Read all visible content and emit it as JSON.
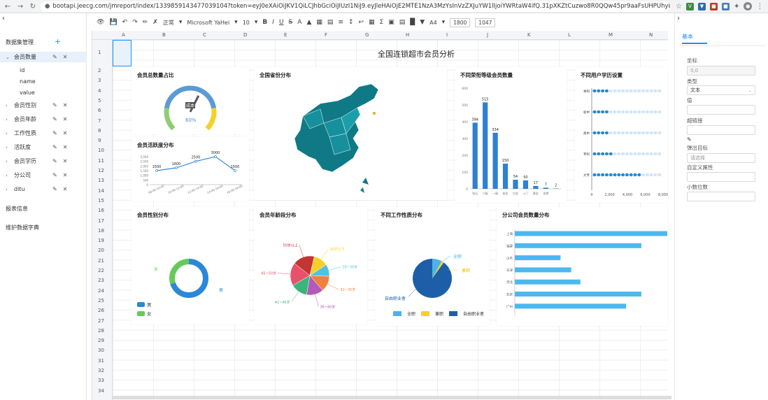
{
  "browser": {
    "url": "bootapi.jeecg.com/jmreport/index/1339859143477039104?token=eyJ0eXAiOiJKV1QiLCJhbGciOiJIUzI1NiJ9.eyJleHAiOjE2MTE1NzA3MzYsInVzZXJuYW1lIjoiYWRtaW4ifQ.31pXKZtCuzwo8R0QQw45pr9aaFsUHPUhybn4XZ9zYpo"
  },
  "left_panel": {
    "dataset_title": "数据集管理",
    "add_label": "+",
    "datasets": [
      {
        "name": "会员数量",
        "expanded": true,
        "fields": [
          "id",
          "name",
          "value"
        ]
      },
      {
        "name": "会员性别"
      },
      {
        "name": "会员年龄"
      },
      {
        "name": "工作性质"
      },
      {
        "name": "活跃度"
      },
      {
        "name": "会员学历"
      },
      {
        "name": "分公司"
      },
      {
        "name": "ditu"
      }
    ],
    "report_info": "报表信息",
    "dict_label": "维护数据字典"
  },
  "toolbar": {
    "font_style": "正常",
    "font_family": "Microsoft YaHei",
    "font_size": "10",
    "paper": "A4",
    "width": "1800",
    "height": "1047"
  },
  "sheet": {
    "columns": [
      "A",
      "B",
      "C",
      "D",
      "E",
      "F",
      "G",
      "H",
      "I",
      "J",
      "K",
      "L",
      "M",
      "N",
      "O"
    ],
    "rows": [
      "1",
      "2",
      "3",
      "4",
      "5",
      "6",
      "7",
      "8",
      "9",
      "10",
      "11",
      "12",
      "13",
      "14",
      "15",
      "16",
      "17",
      "18",
      "19",
      "20",
      "21",
      "22",
      "23",
      "24",
      "25",
      "26",
      "27",
      "28",
      "29",
      "30",
      "31",
      "32",
      "33",
      "34"
    ],
    "title": "全国连锁超市会员分析"
  },
  "charts": {
    "gauge": {
      "title": "会员总数量占比",
      "label": "成本",
      "value_text": "60%"
    },
    "activity": {
      "title": "会员活跃度分布"
    },
    "map": {
      "title": "全国省份分布"
    },
    "bar": {
      "title": "不同荣衔等级会员数量"
    },
    "pictorial": {
      "title": "不同用户学历设置"
    },
    "donut": {
      "title": "会员性别分布",
      "legend": [
        "男",
        "女"
      ],
      "labels": [
        "女",
        "男"
      ]
    },
    "pie": {
      "title": "会员年龄段分布"
    },
    "work": {
      "title": "不同工作性质分布",
      "legend": [
        "全职",
        "兼职",
        "自由职业者"
      ],
      "labels": [
        "全职",
        "兼职",
        "自由职业者"
      ]
    },
    "hbar": {
      "title": "分公司会员数量分布"
    }
  },
  "chart_data": [
    {
      "type": "gauge",
      "title": "会员总数量占比",
      "value": 60,
      "unit": "%",
      "range": [
        0,
        100
      ]
    },
    {
      "type": "line",
      "title": "会员活跃度分布",
      "x": [
        "08:00-10:00",
        "10:00-12:00",
        "12:00-14:00",
        "14:00-16:00",
        "16:00-18:00"
      ],
      "values": [
        1500,
        1800,
        2500,
        3000,
        1500
      ],
      "y_ticks": [
        "0",
        "500",
        "1,000",
        "1,500",
        "2,000",
        "2,500",
        "3,000"
      ],
      "ylim": [
        0,
        3000
      ]
    },
    {
      "type": "bar",
      "title": "不同荣衔等级会员数量",
      "categories": [
        "钻石",
        "二级",
        "一级",
        "铂金",
        "白金",
        "入门",
        "黄金",
        "金牌"
      ],
      "values": [
        394,
        515,
        334,
        150,
        54,
        50,
        17,
        7,
        2
      ],
      "ylim": [
        0,
        600
      ],
      "y_ticks": [
        "0",
        "100",
        "200",
        "300",
        "400",
        "500",
        "600"
      ]
    },
    {
      "type": "bar",
      "title": "不同用户学历设置",
      "categories": [
        "本科",
        "初中",
        "高中",
        "专科",
        "大专"
      ],
      "x_ticks": [
        "0",
        "2,000",
        "4,000",
        "6,000",
        "8,000"
      ],
      "xlim": [
        0,
        8000
      ]
    },
    {
      "type": "pie",
      "title": "会员性别分布",
      "categories": [
        "男",
        "女"
      ],
      "values": [
        70,
        30
      ]
    },
    {
      "type": "pie",
      "title": "会员年龄段分布",
      "categories": [
        "50岁以上",
        "26岁以下",
        "26~30岁",
        "31~35岁",
        "36~40岁",
        "41~45岁",
        "45~50岁"
      ],
      "values": [
        18,
        12,
        10,
        13,
        14,
        14,
        19
      ]
    },
    {
      "type": "pie",
      "title": "不同工作性质分布",
      "categories": [
        "全职",
        "兼职",
        "自由职业者"
      ],
      "values": [
        8,
        2,
        90
      ]
    },
    {
      "type": "bar",
      "title": "分公司会员数量分布",
      "categories": [
        "上海",
        "福建",
        "山东",
        "天津",
        "河北",
        "北京",
        "广州"
      ],
      "values": [
        100,
        83,
        30,
        37,
        43,
        83,
        73
      ],
      "xlim": [
        0,
        100
      ]
    }
  ],
  "right_panel": {
    "tab": "基本",
    "fields": [
      {
        "label": "坐标",
        "value": "0,0",
        "disabled": true
      },
      {
        "label": "类型",
        "value": "文本",
        "select": true
      },
      {
        "label": "值",
        "value": ""
      },
      {
        "label": "超链接",
        "value": ""
      },
      {
        "label": "弹出目标",
        "value": "请选择",
        "select": true
      },
      {
        "label": "自定义属性",
        "value": ""
      },
      {
        "label": "小数位数",
        "value": ""
      }
    ]
  }
}
